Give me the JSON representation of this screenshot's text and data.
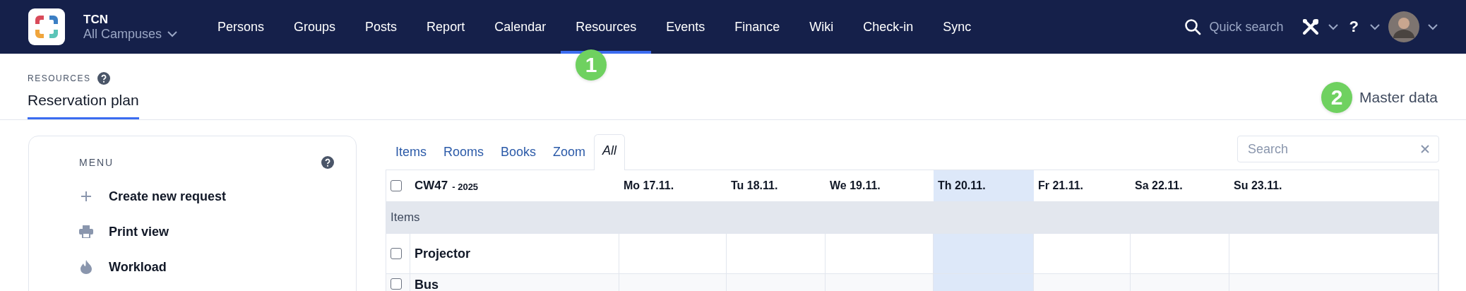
{
  "brand": {
    "name": "TCN",
    "campus": "All Campuses"
  },
  "nav": [
    {
      "label": "Persons",
      "selected": false
    },
    {
      "label": "Groups",
      "selected": false
    },
    {
      "label": "Posts",
      "selected": false
    },
    {
      "label": "Report",
      "selected": false
    },
    {
      "label": "Calendar",
      "selected": false
    },
    {
      "label": "Resources",
      "selected": true
    },
    {
      "label": "Events",
      "selected": false
    },
    {
      "label": "Finance",
      "selected": false
    },
    {
      "label": "Wiki",
      "selected": false
    },
    {
      "label": "Check-in",
      "selected": false
    },
    {
      "label": "Sync",
      "selected": false
    }
  ],
  "quick_search": {
    "placeholder": "Quick search"
  },
  "help_label": "?",
  "callouts": [
    "1",
    "2"
  ],
  "breadcrumb": "RESOURCES",
  "page_tabs": [
    {
      "label": "Reservation plan",
      "selected": true
    }
  ],
  "master_data": "Master data",
  "menu": {
    "title": "MENU",
    "items": [
      {
        "kind": "add",
        "label": "Create new request"
      },
      {
        "kind": "print",
        "label": "Print view"
      },
      {
        "kind": "flame",
        "label": "Workload"
      }
    ]
  },
  "tabs": [
    {
      "label": "Items",
      "selected": false
    },
    {
      "label": "Rooms",
      "selected": false
    },
    {
      "label": "Books",
      "selected": false
    },
    {
      "label": "Zoom",
      "selected": false
    },
    {
      "label": "All",
      "selected": true
    }
  ],
  "search": {
    "placeholder": "Search"
  },
  "table": {
    "week": "CW47",
    "year": "- 2025",
    "checked": false,
    "days": [
      {
        "label": "Mo 17.11.",
        "today": false
      },
      {
        "label": "Tu 18.11.",
        "today": false
      },
      {
        "label": "We 19.11.",
        "today": false
      },
      {
        "label": "Th 20.11.",
        "today": true
      },
      {
        "label": "Fr 21.11.",
        "today": false
      },
      {
        "label": "Sa 22.11.",
        "today": false
      },
      {
        "label": "Su 23.11.",
        "today": false
      }
    ],
    "group": "Items",
    "rows": [
      {
        "name": "Projector",
        "checked": false
      },
      {
        "name": "Bus",
        "checked": false
      }
    ]
  }
}
